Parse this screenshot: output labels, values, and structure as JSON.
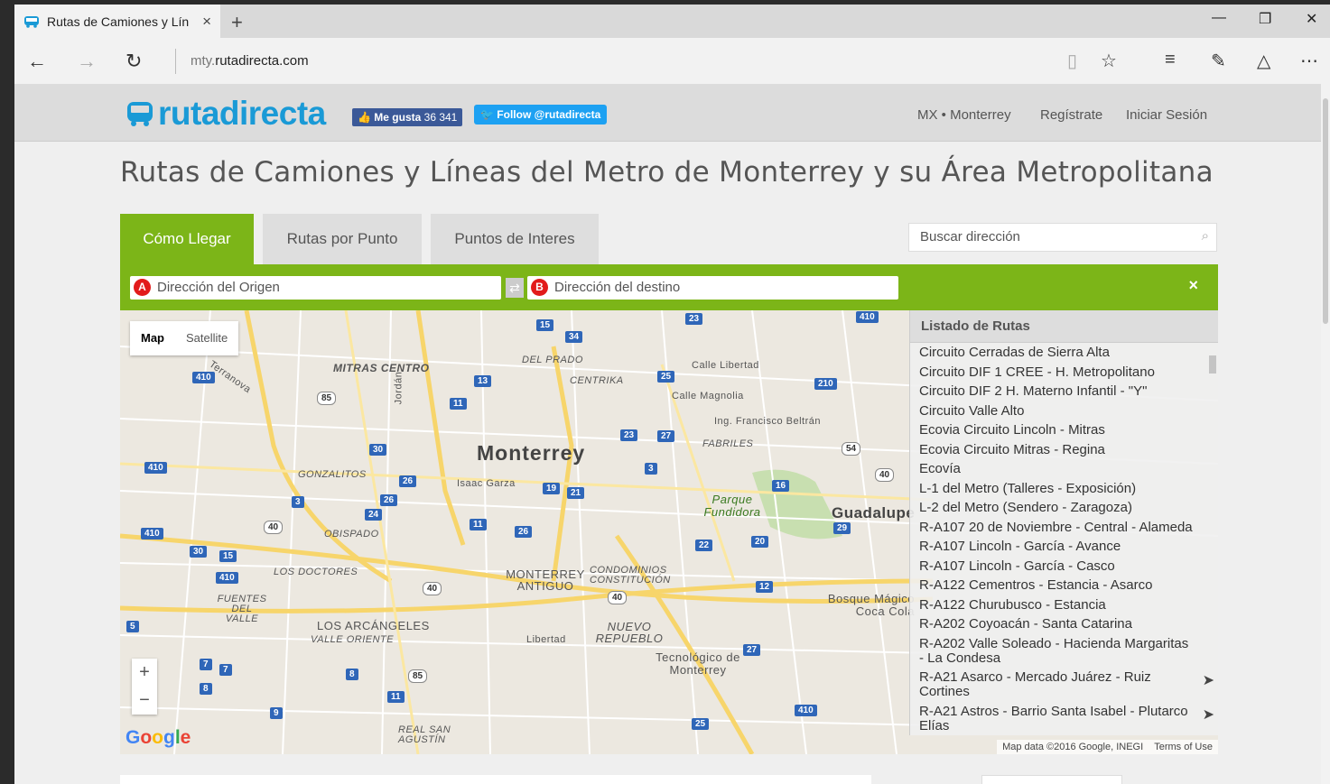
{
  "browser": {
    "tab_title": "Rutas de Camiones y Lín",
    "tab_close": "×",
    "new_tab": "+",
    "minimize": "—",
    "restore": "❐",
    "close": "✕",
    "url_prefix": "mty.",
    "url_domain": "rutadirecta.com"
  },
  "header": {
    "logo_text": "rutadirecta",
    "fb_label": "Me gusta",
    "fb_count": "36 341",
    "twitter_label": "Follow @rutadirecta",
    "region": "MX • Monterrey",
    "register": "Regístrate",
    "login": "Iniciar Sesión"
  },
  "page_title": "Rutas de Camiones y Líneas del Metro de Monterrey y su Área Metropolitana",
  "tabs": [
    "Cómo Llegar",
    "Rutas por Punto",
    "Puntos de Interes"
  ],
  "search_placeholder": "Buscar dirección",
  "origin": {
    "pin": "A",
    "placeholder": "Dirección del Origen"
  },
  "destination": {
    "pin": "B",
    "placeholder": "Dirección del destino"
  },
  "green_close": "×",
  "map": {
    "type_map": "Map",
    "type_satellite": "Satellite",
    "zoom_in": "+",
    "zoom_out": "−",
    "footer_data": "Map data ©2016 Google, INEGI",
    "footer_terms": "Terms of Use",
    "labels": {
      "monterrey": "Monterrey",
      "mitras_centro": "MITRAS CENTRO",
      "del_prado": "DEL PRADO",
      "centrika": "CENTRIKA",
      "calle_libertad": "Calle Libertad",
      "calle_magnolia": "Calle Magnolia",
      "ing_beltran": "Ing. Francisco Beltrán",
      "fabriles": "FABRILES",
      "gonzalitos": "GONZALITOS",
      "obispado": "OBISPADO",
      "los_doctores": "LOS DOCTORES",
      "fuentes": "FUENTES DEL VALLE",
      "los_arcangeles": "LOS ARCÁNGELES",
      "valle_oriente": "VALLE ORIENTE",
      "monterrey_antiguo": "MONTERREY ANTIGUO",
      "condominios": "CONDOMINIOS CONSTITUCIÓN",
      "nuevo_repueblo": "NUEVO REPUEBLO",
      "parque": "Parque Fundidora",
      "guadalupe": "Guadalupe",
      "bosque": "Bosque Mágico Coca Cola",
      "tec": "Tecnológico de Monterrey",
      "real_san_agustin": "REAL SAN AGUSTÍN",
      "isaac_garza": "Isaac Garza",
      "libertad": "Libertad",
      "terranova": "Terranova",
      "jordan": "Jordán"
    },
    "shields": [
      "15",
      "34",
      "23",
      "410",
      "13",
      "25",
      "210",
      "11",
      "410",
      "85",
      "23",
      "27",
      "30",
      "54",
      "410",
      "26",
      "3",
      "3",
      "19",
      "21",
      "16",
      "40",
      "26",
      "24",
      "40",
      "410",
      "30",
      "11",
      "26",
      "15",
      "22",
      "20",
      "29",
      "7",
      "410",
      "40",
      "40",
      "12",
      "5",
      "27",
      "7",
      "8",
      "85",
      "8",
      "11",
      "9",
      "25",
      "410",
      "5"
    ]
  },
  "routes": {
    "heading": "Listado de Rutas",
    "items": [
      "Circuito Cerradas de Sierra Alta",
      "Circuito DIF 1 CREE - H. Metropolitano",
      "Circuito DIF 2 H. Materno Infantil - \"Y\"",
      "Circuito Valle Alto",
      "Ecovia Circuito Lincoln - Mitras",
      "Ecovia Circuito Mitras - Regina",
      "Ecovía",
      "L-1 del Metro (Talleres - Exposición)",
      "L-2 del Metro (Sendero - Zaragoza)",
      "R-A107 20 de Noviembre - Central - Alameda",
      "R-A107 Lincoln - García - Avance",
      "R-A107 Lincoln - García - Casco",
      "R-A122 Cementros - Estancia - Asarco",
      "R-A122 Churubusco - Estancia",
      "R-A202 Coyoacán - Santa Catarina",
      "R-A202 Valle Soleado - Hacienda Margaritas - La Condesa",
      "R-A21 Asarco - Mercado Juárez - Ruiz Cortines",
      "R-A21 Astros - Barrio Santa Isabel - Plutarco Elías"
    ]
  },
  "colors": {
    "brand_green": "#7cb518",
    "brand_blue": "#1a9ad6",
    "pin_red": "#e21b1b"
  }
}
